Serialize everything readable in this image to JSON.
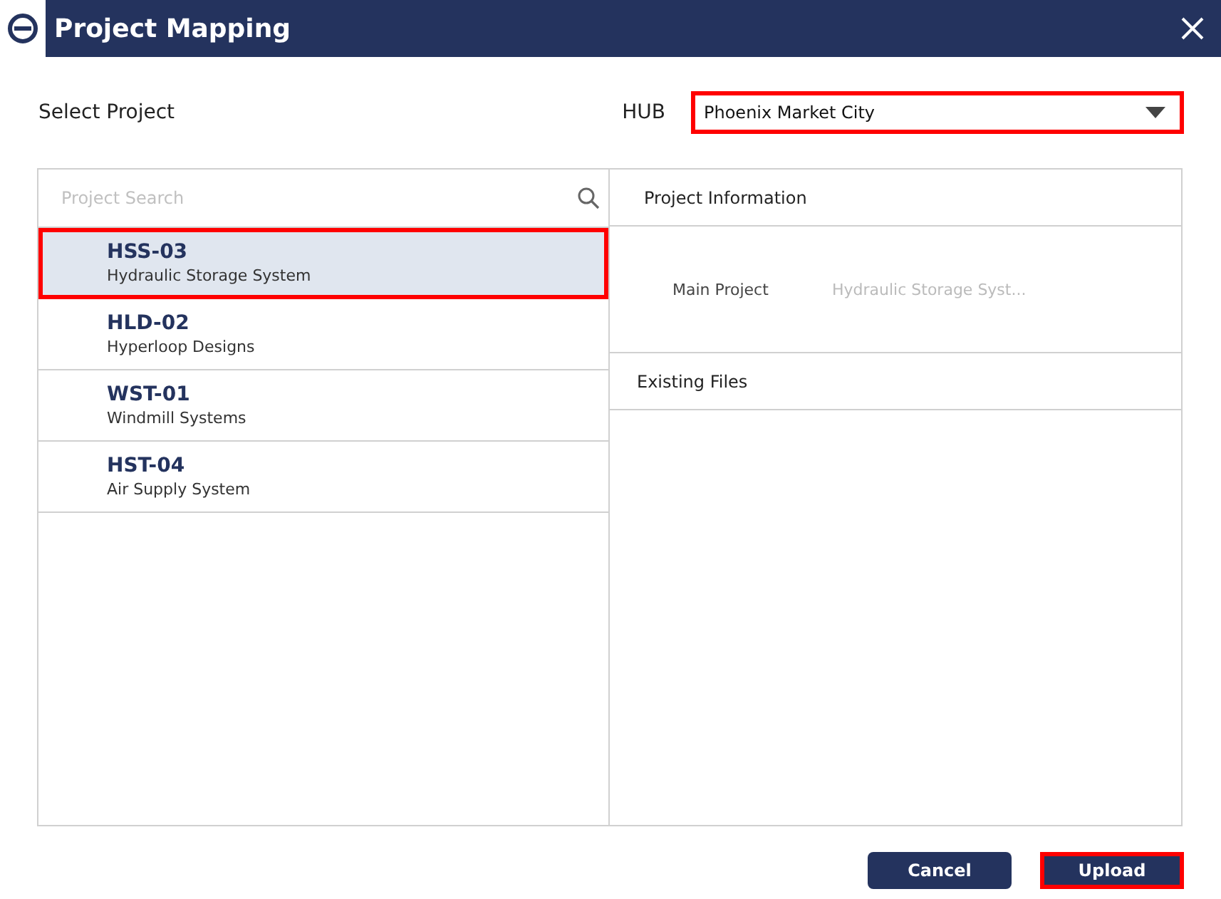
{
  "window": {
    "title": "Project Mapping"
  },
  "select_label": "Select Project",
  "hub": {
    "label": "HUB",
    "value": "Phoenix Market City",
    "highlighted": true
  },
  "search": {
    "placeholder": "Project Search"
  },
  "projects": [
    {
      "code": "HSS-03",
      "name": "Hydraulic Storage System",
      "selected": true
    },
    {
      "code": "HLD-02",
      "name": "Hyperloop Designs",
      "selected": false
    },
    {
      "code": "WST-01",
      "name": "Windmill Systems",
      "selected": false
    },
    {
      "code": "HST-04",
      "name": "Air Supply System",
      "selected": false
    }
  ],
  "info": {
    "heading": "Project Information",
    "rows": [
      {
        "label": "Main Project",
        "value": "Hydraulic Storage Syst..."
      }
    ]
  },
  "files": {
    "heading": "Existing Files"
  },
  "buttons": [
    {
      "label": "Cancel",
      "highlighted": false
    },
    {
      "label": "Upload",
      "highlighted": true
    }
  ]
}
